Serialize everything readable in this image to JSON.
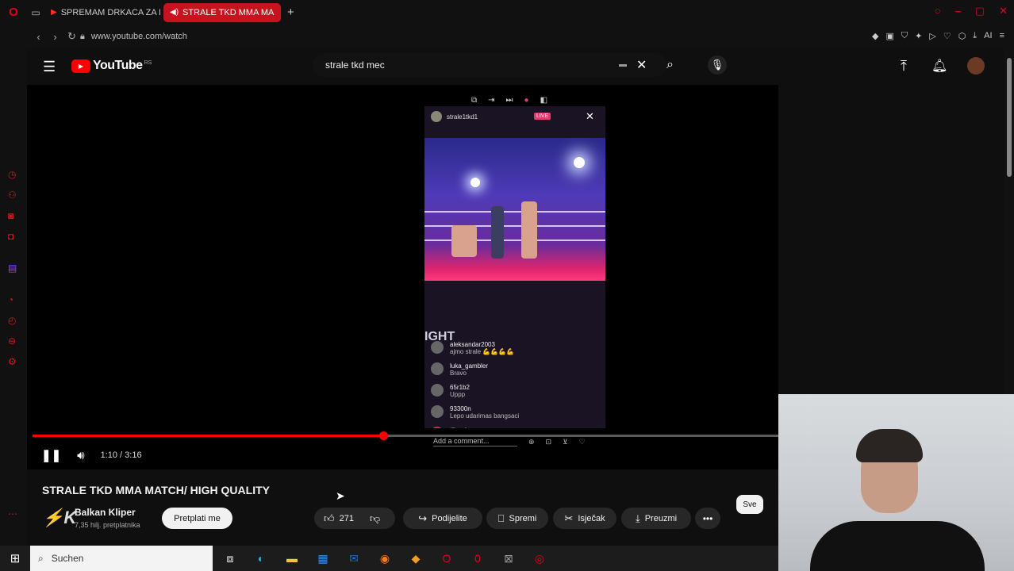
{
  "browser": {
    "tabs": [
      {
        "label": "SPREMAM DRKACA ZA B",
        "active": false
      },
      {
        "label": "STRALE TKD MMA MA",
        "active": true
      }
    ],
    "url": "www.youtube.com/watch"
  },
  "youtube": {
    "logo_text": "YouTube",
    "country_code": "RS",
    "search_value": "strale tkd mec"
  },
  "player": {
    "time": "1:10 / 3:16",
    "progress": 0.47,
    "video": {
      "username": "strale1tkd1",
      "live_label": "LIVE",
      "fight_label": "IGHT",
      "comments": [
        {
          "user": "aleksandar2003",
          "text": "ajmo strale 💪💪💪💪"
        },
        {
          "user": "luka_gambler",
          "text": "Bravo"
        },
        {
          "user": "65r1b2",
          "text": "Uppp"
        },
        {
          "user": "93300n",
          "text": "Lepo udarimas bangsaci"
        },
        {
          "user": "tiltervic",
          "text": ""
        }
      ],
      "add_comment": "Add a comment..."
    }
  },
  "video_info": {
    "title": "STRALE TKD MMA MATCH/ HIGH QUALITY",
    "channel": "Balkan Kliper",
    "subscribers": "7,35 hilj. pretplatnika",
    "subscribe_label": "Pretplati me",
    "likes": "271",
    "share_label": "Podijelite",
    "save_label": "Spremi",
    "clip_label": "Isječak",
    "download_label": "Preuzmi",
    "chip_label": "Sve"
  },
  "taskbar": {
    "search_placeholder": "Suchen"
  },
  "colors": {
    "opera_red": "#e3001b",
    "youtube_red": "#ff0000",
    "background": "#0f0f0f"
  }
}
